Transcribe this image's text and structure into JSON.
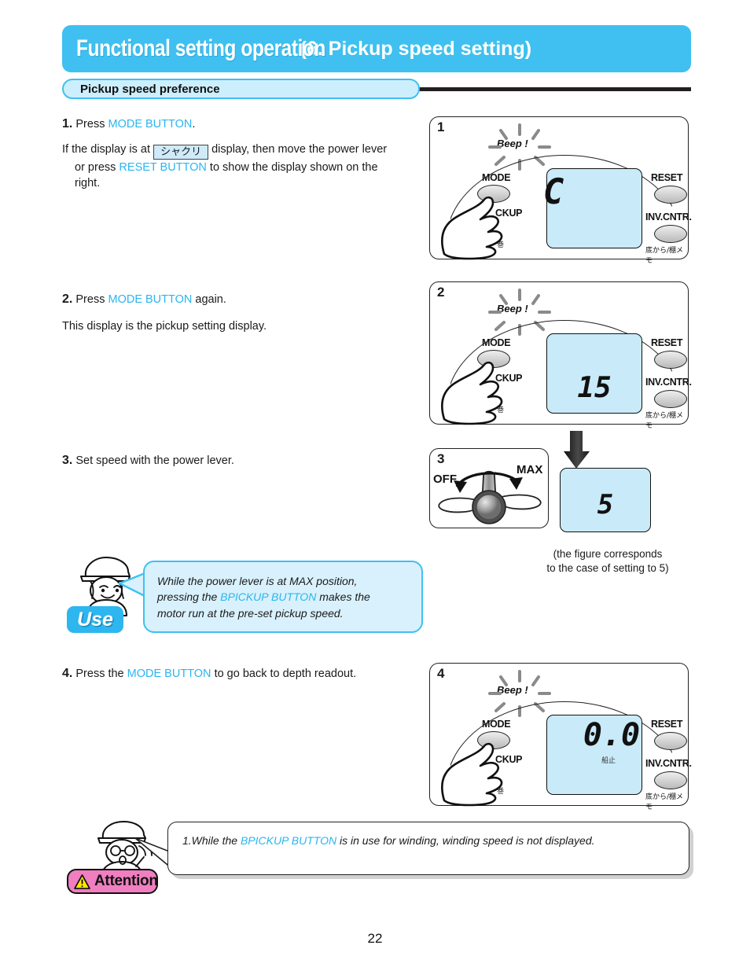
{
  "header": {
    "title_main": "Functional setting operation",
    "title_sub": "(6. Pickup speed setting)",
    "subhead": "Pickup speed preference",
    "accent_blue": "#3fc0f0",
    "rule_color": "#231f20"
  },
  "steps": [
    {
      "num": "1.",
      "lead": "Press",
      "link": "MODE BUTTON",
      "tail": ".",
      "body_a": "If the display is at",
      "badge": "シャクリ",
      "body_b": "display, then move the power lever",
      "body_c_pre": "or press",
      "body_c_link": "RESET BUTTON",
      "body_c_post": "to show the display shown on the",
      "body_d": "right."
    },
    {
      "num": "2.",
      "lead": "Press",
      "link": "MODE BUTTON",
      "tail": "again.",
      "body_a": "This display is the pickup setting display."
    },
    {
      "num": "3.",
      "lead": "Set speed with the power lever."
    },
    {
      "num": "4.",
      "lead": "Press the",
      "link": "MODE BUTTON",
      "tail": "to go back to depth readout."
    }
  ],
  "panels": [
    {
      "number": "1",
      "beep": "Beep !",
      "lcd_value": "C",
      "lcd_sub": "",
      "labels": {
        "mode": "MODE",
        "pickup": "CKUP",
        "wind": "巻",
        "reset": "RESET",
        "invcntr": "INV.CNTR.",
        "memo": "底から/棚メモ"
      }
    },
    {
      "number": "2",
      "beep": "Beep !",
      "lcd_value": "15",
      "lcd_sub": "",
      "labels": {
        "mode": "MODE",
        "pickup": "CKUP",
        "wind": "巻",
        "reset": "RESET",
        "invcntr": "INV.CNTR.",
        "memo": "底から/棚メモ"
      }
    },
    {
      "number": "4",
      "beep": "Beep !",
      "lcd_value": "0.0",
      "lcd_sub": "船止",
      "labels": {
        "mode": "MODE",
        "pickup": "CKUP",
        "wind": "巻",
        "reset": "RESET",
        "invcntr": "INV.CNTR.",
        "memo": "底から/棚メモ"
      }
    }
  ],
  "lever": {
    "number": "3",
    "off_label": "OFF",
    "max_label": "MAX"
  },
  "result_display": {
    "value": "5",
    "caption_line1": "(the figure corresponds",
    "caption_line2": " to the case of setting to 5)"
  },
  "use_callout": {
    "badge": "Use",
    "text_a": "While the power lever is at MAX position,",
    "text_b_pre": "pressing the",
    "text_b_link": "BPICKUP BUTTON",
    "text_b_post": "makes the",
    "text_c": "motor run at the pre-set pickup speed."
  },
  "attention_callout": {
    "badge": "Attention",
    "warning_icon": "warning-triangle-icon",
    "text_pre": "1.While the",
    "text_link": "BPICKUP BUTTON",
    "text_post": "is in use for winding, winding speed is not displayed."
  },
  "footer": {
    "page_number": "22"
  }
}
